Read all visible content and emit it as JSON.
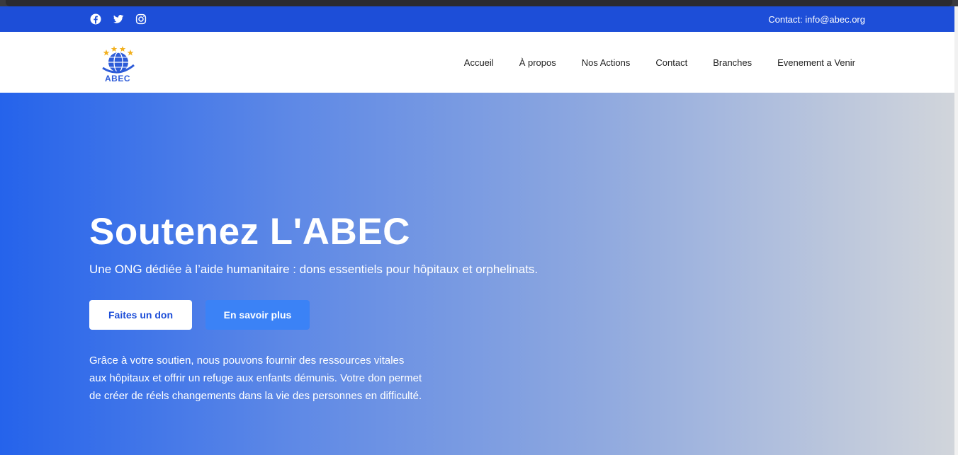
{
  "topbar": {
    "socials": [
      {
        "icon": "facebook-icon"
      },
      {
        "icon": "twitter-icon"
      },
      {
        "icon": "instagram-icon"
      }
    ],
    "contact": "Contact: info@abec.org",
    "color": "#1d4ed8"
  },
  "navbar": {
    "logo_text": "ABEC",
    "items": [
      "Accueil",
      "À propos",
      "Nos Actions",
      "Contact",
      "Branches",
      "Evenement a Venir"
    ]
  },
  "hero": {
    "title": "Soutenez L'ABEC",
    "subtitle": "Une ONG dédiée à l’aide humanitaire : dons essentiels pour hôpitaux et orphelinats.",
    "primary_button": "Faites un don",
    "secondary_button": "En savoir plus",
    "description": "Grâce à votre soutien, nous pouvons fournir des ressources vitales aux hôpitaux et offrir un refuge aux enfants démunis. Votre don permet de créer de réels changements dans la vie des personnes en difficulté.",
    "gradient": [
      "#2563eb",
      "#d1d5db"
    ]
  }
}
